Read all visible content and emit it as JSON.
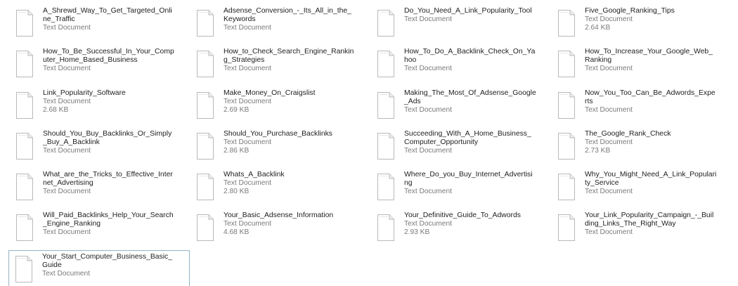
{
  "files": [
    {
      "name": "A_Shrewd_Way_To_Get_Targeted_Online_Traffic",
      "type": "Text Document",
      "size": ""
    },
    {
      "name": "Adsense_Conversion_-_Its_All_in_the_Keywords",
      "type": "Text Document",
      "size": ""
    },
    {
      "name": "Do_You_Need_A_Link_Popularity_Tool",
      "type": "Text Document",
      "size": ""
    },
    {
      "name": "Five_Google_Ranking_Tips",
      "type": "Text Document",
      "size": "2.64 KB"
    },
    {
      "name": "How_To_Be_Successful_In_Your_Computer_Home_Based_Business",
      "type": "Text Document",
      "size": ""
    },
    {
      "name": "How_to_Check_Search_Engine_Ranking_Strategies",
      "type": "Text Document",
      "size": ""
    },
    {
      "name": "How_To_Do_A_Backlink_Check_On_Yahoo",
      "type": "Text Document",
      "size": ""
    },
    {
      "name": "How_To_Increase_Your_Google_Web_Ranking",
      "type": "Text Document",
      "size": ""
    },
    {
      "name": "Link_Popularity_Software",
      "type": "Text Document",
      "size": "2.68 KB"
    },
    {
      "name": "Make_Money_On_Craigslist",
      "type": "Text Document",
      "size": "2.69 KB"
    },
    {
      "name": "Making_The_Most_Of_Adsense_Google_Ads",
      "type": "Text Document",
      "size": ""
    },
    {
      "name": "Now_You_Too_Can_Be_Adwords_Experts",
      "type": "Text Document",
      "size": ""
    },
    {
      "name": "Should_You_Buy_Backlinks_Or_Simply_Buy_A_Backlink",
      "type": "Text Document",
      "size": ""
    },
    {
      "name": "Should_You_Purchase_Backlinks",
      "type": "Text Document",
      "size": "2.86 KB"
    },
    {
      "name": "Succeeding_With_A_Home_Business_Computer_Opportunity",
      "type": "Text Document",
      "size": ""
    },
    {
      "name": "The_Google_Rank_Check",
      "type": "Text Document",
      "size": "2.73 KB"
    },
    {
      "name": "What_are_the_Tricks_to_Effective_Internet_Advertising",
      "type": "Text Document",
      "size": ""
    },
    {
      "name": "Whats_A_Backlink",
      "type": "Text Document",
      "size": "2.80 KB"
    },
    {
      "name": "Where_Do_you_Buy_Internet_Advertising",
      "type": "Text Document",
      "size": ""
    },
    {
      "name": "Why_You_Might_Need_A_Link_Popularity_Service",
      "type": "Text Document",
      "size": ""
    },
    {
      "name": "Will_Paid_Backlinks_Help_Your_Search_Engine_Ranking",
      "type": "Text Document",
      "size": ""
    },
    {
      "name": "Your_Basic_Adsense_Information",
      "type": "Text Document",
      "size": "4.68 KB"
    },
    {
      "name": "Your_Definitive_Guide_To_Adwords",
      "type": "Text Document",
      "size": "2.93 KB"
    },
    {
      "name": "Your_Link_Popularity_Campaign_-_Building_Links_The_Right_Way",
      "type": "Text Document",
      "size": ""
    },
    {
      "name": "Your_Start_Computer_Business_Basic_Guide",
      "type": "Text Document",
      "size": "",
      "selected": true
    }
  ],
  "icon": "text-document-icon",
  "colors": {
    "name_text": "#1e1e1e",
    "meta_text": "#7a7a7a",
    "selection_border": "#8fb6dc"
  }
}
